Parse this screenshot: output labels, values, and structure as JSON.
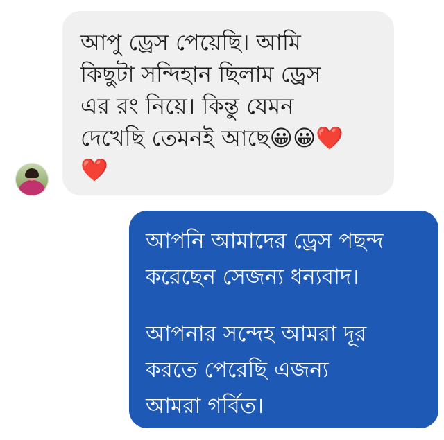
{
  "incoming": {
    "lines": [
      "আপু ড্রেস পেয়েছি।  আমি",
      "কিছুটা সন্দিহান ছিলাম ড্রেস",
      "এর রং নিয়ে। কিন্তু যেমন",
      "দেখেছি তেমনই আছে😀😀❤️",
      "❤️"
    ]
  },
  "outgoing": {
    "paragraph1": [
      "আপনি আমাদের ড্রেস পছন্দ",
      "করেছেন সেজন্য ধন্যবাদ।"
    ],
    "paragraph2": [
      "আপনার সন্দেহ আমরা দূর",
      "করতে পেরেছি এজন্য",
      "আমরা গর্বিত।"
    ]
  },
  "colors": {
    "incoming_bg": "#f0f0f0",
    "outgoing_bg": "#1e59b6",
    "outgoing_text": "#ffffff"
  }
}
